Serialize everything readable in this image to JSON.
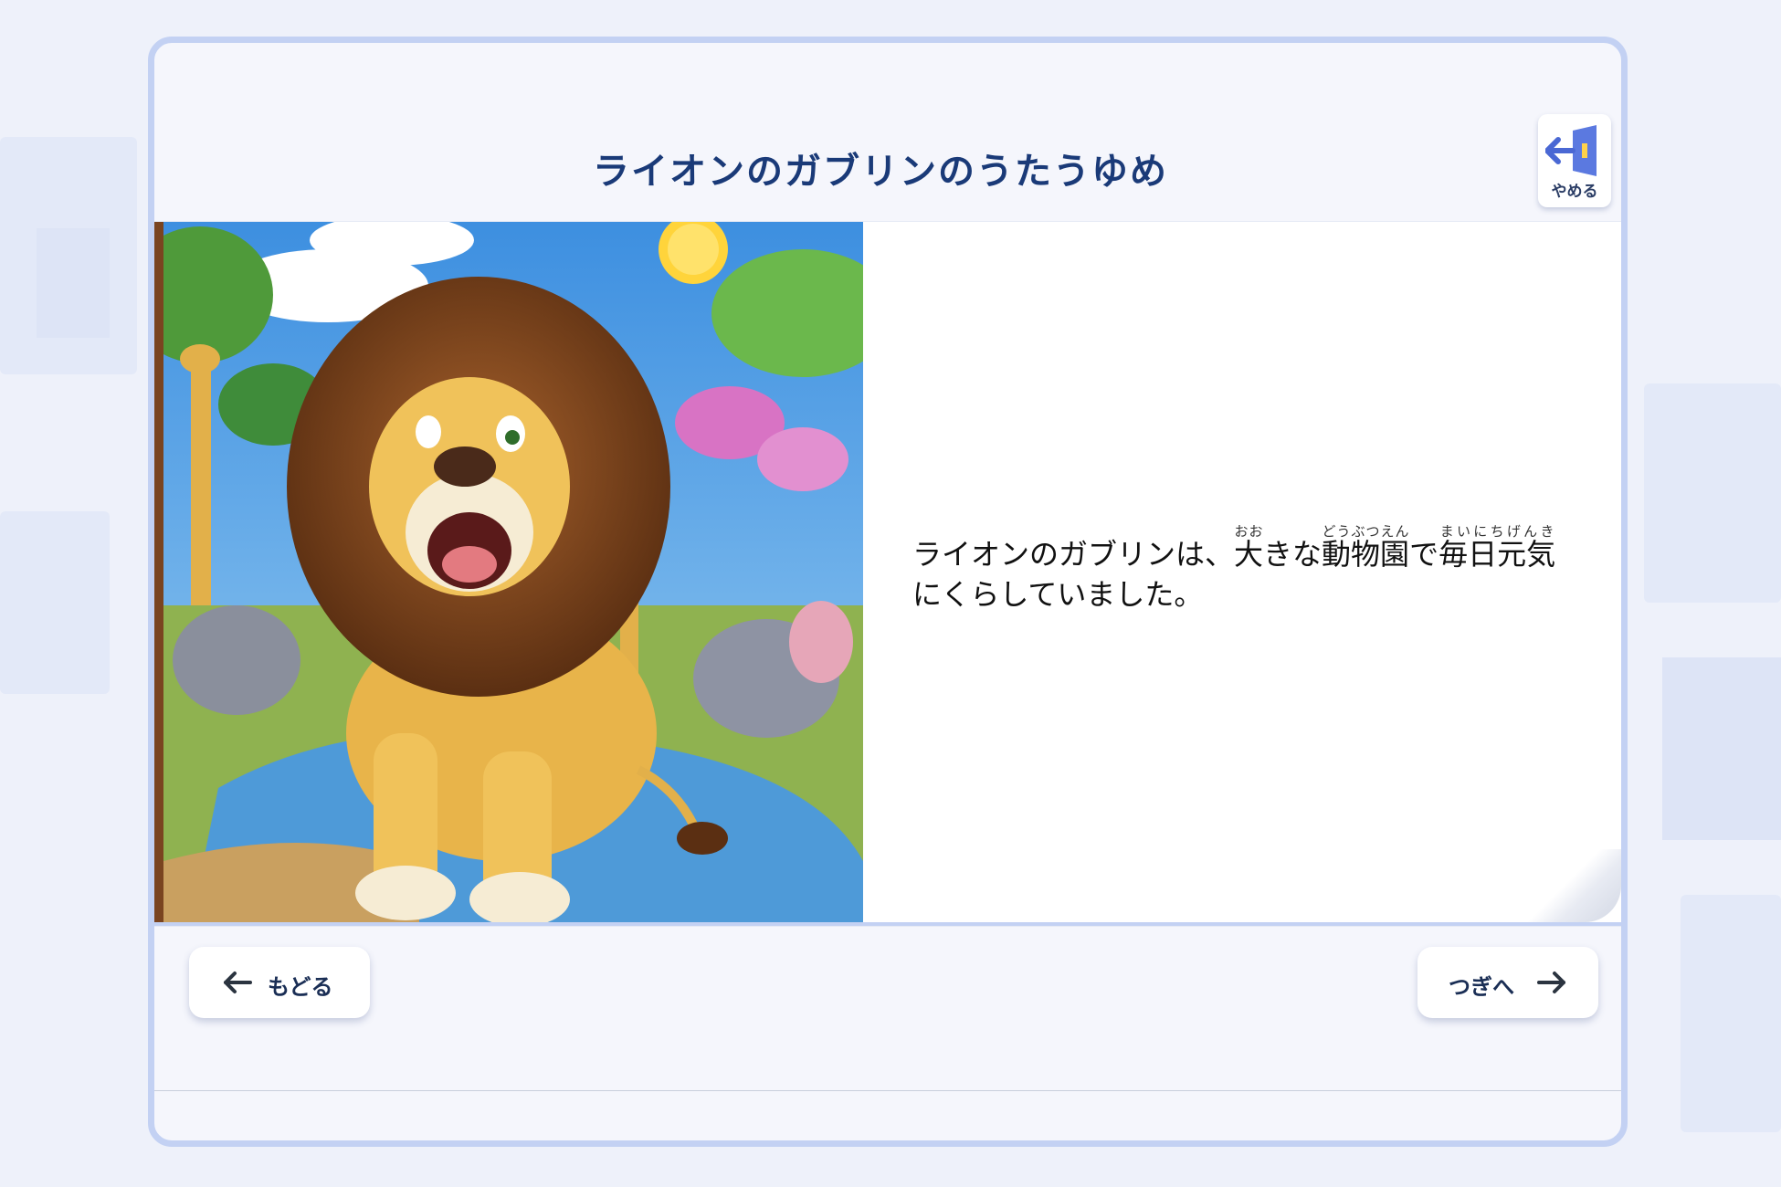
{
  "header": {
    "title": "ライオンのガブリンのうたうゆめ",
    "quit_label": "やめる"
  },
  "page": {
    "story_lines": [
      {
        "text": "ライオンのガブリンは、"
      },
      {
        "text": "大",
        "ruby": "おお"
      },
      {
        "text": "きな"
      },
      {
        "text": "動物園",
        "ruby": "どうぶつえん"
      },
      {
        "text": "で"
      },
      {
        "text": "毎日元気",
        "ruby": "まいにちげんき"
      },
      {
        "text": "にくらしていました。"
      }
    ]
  },
  "nav": {
    "back_label": "もどる",
    "next_label": "つぎへ"
  },
  "colors": {
    "accent": "#1a3a78",
    "frame_border": "#c3d1f3"
  },
  "icons": [
    "exit-door-icon",
    "arrow-left-icon",
    "arrow-right-icon"
  ]
}
